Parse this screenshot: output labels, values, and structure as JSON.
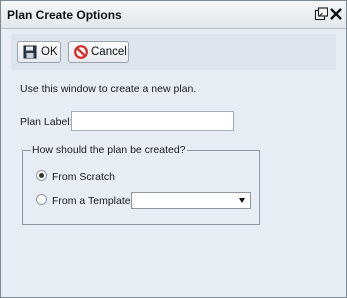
{
  "window": {
    "title": "Plan Create Options",
    "restore_icon": "restore-window-icon",
    "close_icon": "close-icon"
  },
  "toolbar": {
    "ok_label": "OK",
    "ok_icon": "floppy-disk-icon",
    "cancel_label": "Cancel",
    "cancel_icon": "no-entry-icon"
  },
  "form": {
    "instructions": "Use this window to create a new plan.",
    "plan_label_label": "Plan Label:",
    "plan_label_value": "",
    "group_legend": "How should the plan be created?",
    "options": [
      {
        "label": "From Scratch",
        "selected": true
      },
      {
        "label": "From a Template",
        "selected": false
      }
    ],
    "template_select_value": ""
  },
  "colors": {
    "cancel_icon_red": "#d62a20",
    "window_bg": "#e8edf3",
    "toolbar_bg": "#dde4ec"
  }
}
